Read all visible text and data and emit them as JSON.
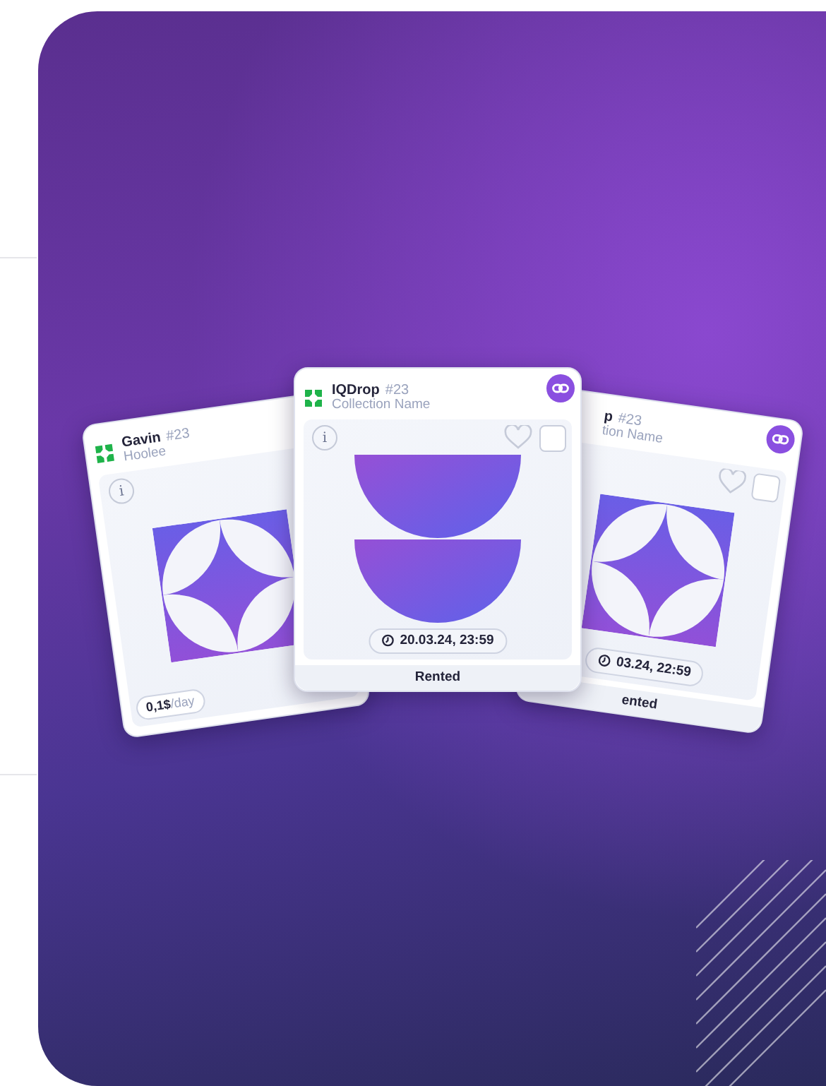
{
  "cards": [
    {
      "kind": "price",
      "artwork": {
        "kind": "star"
      },
      "info_label": "i",
      "title": "Gavin",
      "number": "#23",
      "collection": "Hoolee",
      "price": "0,1$",
      "price_unit": "/day"
    },
    {
      "kind": "rented",
      "artwork": {
        "kind": "halves"
      },
      "info_label": "i",
      "title": "IQDrop",
      "number": "#23",
      "collection": "Collection Name",
      "chain_badge": true,
      "favorited": false,
      "checked": false,
      "date": "20.03.24, 23:59",
      "status": "Rented"
    },
    {
      "kind": "rented",
      "artwork": {
        "kind": "star"
      },
      "title": "p",
      "number": "#23",
      "collection": "tion Name",
      "chain_badge": true,
      "favorited": false,
      "checked": false,
      "date": "03.24, 22:59",
      "status": "ented"
    }
  ]
}
